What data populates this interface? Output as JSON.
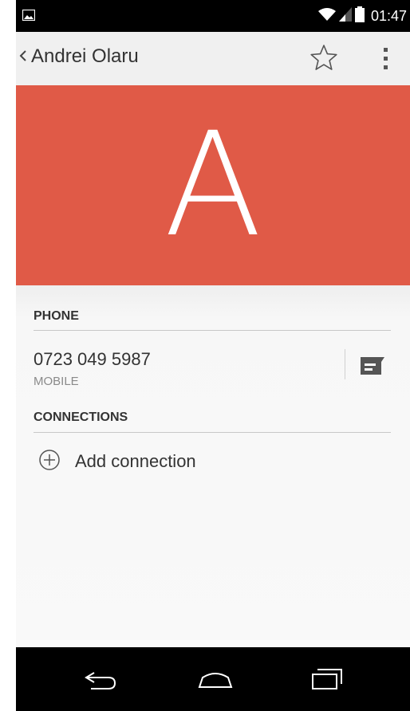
{
  "status_bar": {
    "time": "01:47"
  },
  "action_bar": {
    "contact_name": "Andrei Olaru"
  },
  "header": {
    "avatar_letter": "A",
    "color": "#e05a47"
  },
  "phone_section": {
    "title": "PHONE",
    "number": "0723 049 5987",
    "type": "MOBILE"
  },
  "connections_section": {
    "title": "CONNECTIONS",
    "add_label": "Add connection"
  },
  "icons": {
    "status": [
      "picture-icon",
      "wifi-icon",
      "signal-icon",
      "battery-icon"
    ],
    "action_bar": [
      "back-chevron-icon",
      "star-icon",
      "overflow-menu-icon"
    ],
    "nav": [
      "back-icon",
      "home-icon",
      "recents-icon"
    ]
  }
}
